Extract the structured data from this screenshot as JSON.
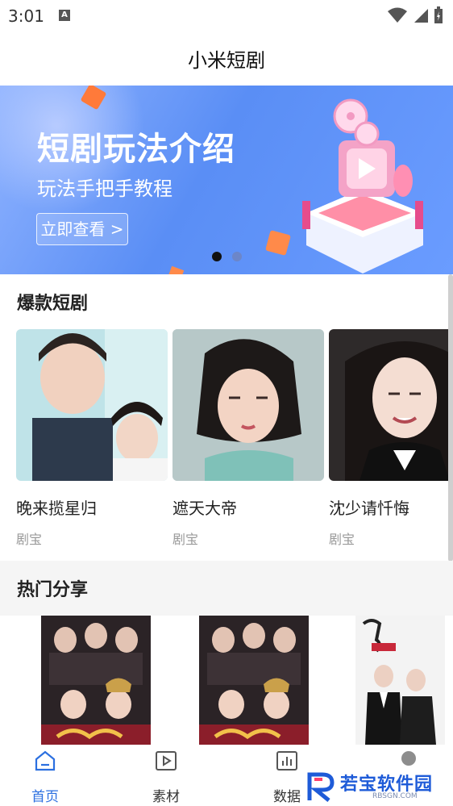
{
  "status_bar": {
    "time": "3:01",
    "notification_icon": "A"
  },
  "header": {
    "title": "小米短剧"
  },
  "banner": {
    "headline": "短剧玩法介绍",
    "subtitle": "玩法手把手教程",
    "button_label": "立即查看 >",
    "carousel_pages": 2,
    "active_page": 1
  },
  "hot_dramas": {
    "title": "爆款短剧",
    "items": [
      {
        "name": "晚来揽星归",
        "source": "剧宝"
      },
      {
        "name": "遮天大帝",
        "source": "剧宝"
      },
      {
        "name": "沈少请忏悔",
        "source": "剧宝"
      }
    ]
  },
  "popular_share": {
    "title": "热门分享"
  },
  "bottom_nav": {
    "items": [
      {
        "label": "首页",
        "icon": "home-icon",
        "active": true
      },
      {
        "label": "素材",
        "icon": "play-square-icon",
        "active": false
      },
      {
        "label": "数据",
        "icon": "chart-icon",
        "active": false
      }
    ]
  },
  "watermark": {
    "text": "若宝软件园",
    "url": "RBSGN.COM"
  },
  "colors": {
    "accent": "#2b6fe0",
    "banner": "#5a8ef5"
  }
}
